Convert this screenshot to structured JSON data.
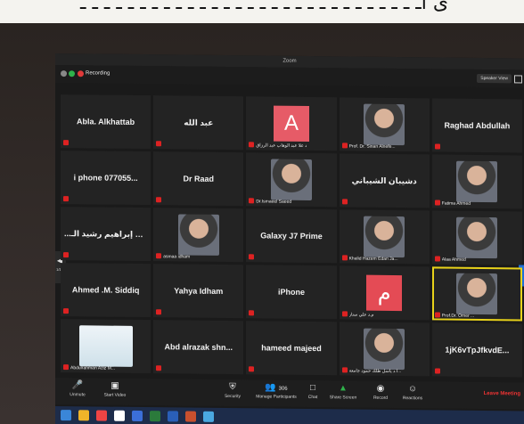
{
  "photo": {
    "caption": "ى اـ ـ  ـ ـ  ـ ـ ـ ـ ـ ـ ـ ـ  ـ ـ ـ ـ ـ ـ ـ ـ ـ ـ ـ ـ ـ ـ ـ ـ ـ"
  },
  "window": {
    "title": "Zoom"
  },
  "topbar": {
    "recording": "Recording",
    "speaker_view": "Speaker View"
  },
  "pager": {
    "left_label": "1/12"
  },
  "tiles": [
    {
      "name": "Abla. Alkhattab"
    },
    {
      "name": "عبد الله"
    },
    {
      "letter": "A",
      "letter_color": "#e65b67",
      "caption": "د علا عبد الوهاب عبد الرزاق"
    },
    {
      "photo": "portrait",
      "caption": "Prof. Dr. Sinan Alnefe..."
    },
    {
      "name": "Raghad Abdullah"
    },
    {
      "name": "i phone 077055..."
    },
    {
      "name": "Dr Raad"
    },
    {
      "photo": "portrait",
      "caption": "Dr.Ismaeel Saeed"
    },
    {
      "name": "دشيبان الشيباني"
    },
    {
      "photo": "portrait",
      "caption": "Fatima Ahmed"
    },
    {
      "name": "...طه إبراهيم رشيد الـ"
    },
    {
      "photo": "portrait",
      "caption": "asmaa idham"
    },
    {
      "name": "Galaxy J7 Prime"
    },
    {
      "photo": "portrait",
      "caption": "Khalid Hazem Edan Ja..."
    },
    {
      "photo": "portrait",
      "caption": "Alaa Ahmed"
    },
    {
      "name": "Ahmed .M. Siddiq"
    },
    {
      "name": "Yahya Idham"
    },
    {
      "name": "iPhone"
    },
    {
      "letter": "م",
      "letter_color": "#e44b55",
      "caption": "م.د علي ستار"
    },
    {
      "photo": "portrait",
      "caption": "Prof.Dr. Omer ...",
      "active": true
    },
    {
      "photo": "logo",
      "caption": "Abdulrahman Aziz M..."
    },
    {
      "name": "Abd alrazak shn..."
    },
    {
      "name": "hameed majeed"
    },
    {
      "photo": "portrait",
      "caption": "أ.د ياسل طلك حمود جامعة..."
    },
    {
      "name": "1jK6vTpJfkvdE..."
    }
  ],
  "controls": {
    "unmute": "Unmute",
    "start_video": "Start Video",
    "security": "Security",
    "manage_participants": "Manage Participants",
    "participant_count": "306",
    "chat": "Chat",
    "share_screen": "Share Screen",
    "record": "Record",
    "reactions": "Reactions",
    "leave": "Leave Meeting"
  },
  "colors": {
    "tile_bg": "#232323",
    "mute_red": "#d22222",
    "active_border": "#e8d21a",
    "share_green": "#2fb24b"
  }
}
